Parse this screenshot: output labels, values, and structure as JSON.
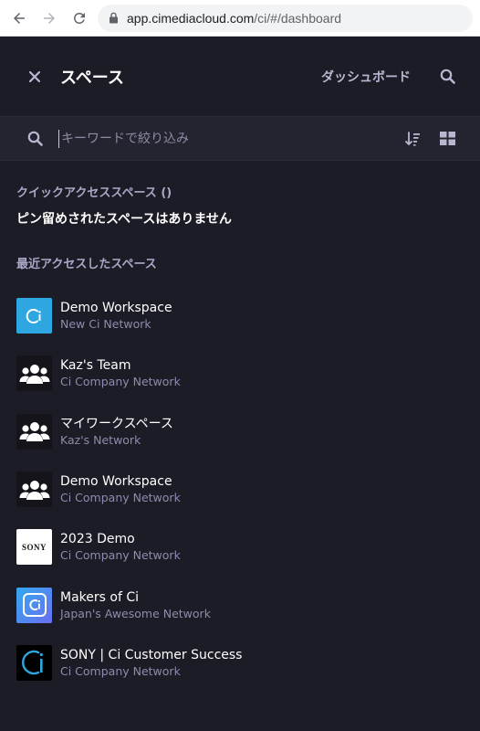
{
  "browser": {
    "url_host": "app.cimediacloud.com",
    "url_path": "/ci/#/dashboard"
  },
  "header": {
    "title": "スペース",
    "dashboard_link": "ダッシュボード"
  },
  "filter": {
    "placeholder": "キーワードで絞り込み"
  },
  "quick_access": {
    "label": "クイックアクセススペース ()",
    "empty_message": "ピン留めされたスペースはありません"
  },
  "recent": {
    "label": "最近アクセスしたスペース",
    "items": [
      {
        "name": "Demo Workspace",
        "network": "New Ci Network",
        "icon": "ci-logo-icon"
      },
      {
        "name": "Kaz's Team",
        "network": "Ci Company Network",
        "icon": "team-icon"
      },
      {
        "name": "マイワークスペース",
        "network": "Kaz's Network",
        "icon": "team-icon"
      },
      {
        "name": "Demo Workspace",
        "network": "Ci Company Network",
        "icon": "team-icon"
      },
      {
        "name": "2023 Demo",
        "network": "Ci Company Network",
        "icon": "sony-logo-icon",
        "logo_text": "SONY"
      },
      {
        "name": "Makers of Ci",
        "network": "Japan's Awesome Network",
        "icon": "ci-logo-icon"
      },
      {
        "name": "SONY | Ci Customer Success",
        "network": "Ci Company Network",
        "icon": "ci-logo-icon"
      }
    ]
  },
  "colors": {
    "background": "#1c1c26",
    "filter_bar": "#242430",
    "accent_text": "#a8a8c8",
    "secondary_text": "#8c8cae"
  }
}
